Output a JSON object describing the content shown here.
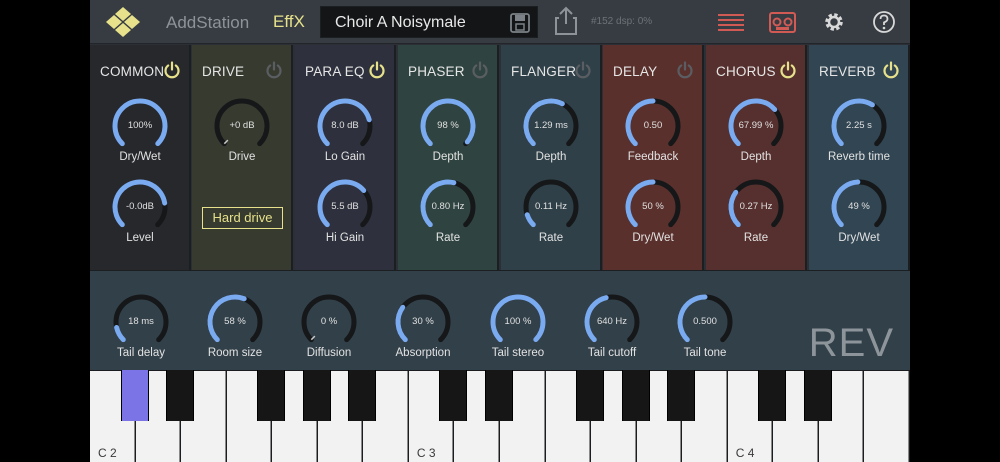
{
  "header": {
    "app_name": "AddStation",
    "module": "EffX",
    "preset_name": "Choir A Noisymale",
    "status": "#152  dsp: 0%"
  },
  "effects": [
    {
      "title": "COMMON",
      "power": "on",
      "color": "#26282c",
      "knobs": [
        {
          "value": "100%",
          "label": "Dry/Wet",
          "fill": 1.0
        },
        {
          "value": "-0.0dB",
          "label": "Level",
          "fill": 0.8
        }
      ]
    },
    {
      "title": "DRIVE",
      "power": "off",
      "color": "#363a2f",
      "knobs": [
        {
          "value": "+0 dB",
          "label": "Drive",
          "fill": 0.0
        }
      ],
      "button": "Hard drive"
    },
    {
      "title": "PARA EQ",
      "power": "on",
      "color": "#2e313d",
      "knobs": [
        {
          "value": "8.0 dB",
          "label": "Lo Gain",
          "fill": 0.78
        },
        {
          "value": "5.5 dB",
          "label": "Hi Gain",
          "fill": 0.68
        }
      ]
    },
    {
      "title": "PHASER",
      "power": "off",
      "color": "#2f4440",
      "knobs": [
        {
          "value": "98 %",
          "label": "Depth",
          "fill": 0.98
        },
        {
          "value": "0.80 Hz",
          "label": "Rate",
          "fill": 0.55
        }
      ]
    },
    {
      "title": "FLANGER",
      "power": "off",
      "color": "#2f4048",
      "knobs": [
        {
          "value": "1.29  ms",
          "label": "Depth",
          "fill": 0.6
        },
        {
          "value": "0.11  Hz",
          "label": "Rate",
          "fill": 0.1
        }
      ]
    },
    {
      "title": "DELAY",
      "power": "off",
      "color": "#5a302c",
      "knobs": [
        {
          "value": "0.50",
          "label": "Feedback",
          "fill": 0.5
        },
        {
          "value": "50   %",
          "label": "Dry/Wet",
          "fill": 0.5
        }
      ]
    },
    {
      "title": "CHORUS",
      "power": "on",
      "color": "#56302e",
      "knobs": [
        {
          "value": "67.99 %",
          "label": "Depth",
          "fill": 0.68
        },
        {
          "value": "0.27  Hz",
          "label": "Rate",
          "fill": 0.3
        }
      ]
    },
    {
      "title": "REVERB",
      "power": "on",
      "color": "#314552",
      "knobs": [
        {
          "value": "2.25 s",
          "label": "Reverb time",
          "fill": 0.62
        },
        {
          "value": "49 %",
          "label": "Dry/Wet",
          "fill": 0.49
        }
      ]
    }
  ],
  "reverb_detail": {
    "title": "REV",
    "knobs": [
      {
        "value": "18 ms",
        "label": "Tail delay",
        "fill": 0.12
      },
      {
        "value": "58 %",
        "label": "Room size",
        "fill": 0.58
      },
      {
        "value": "0 %",
        "label": "Diffusion",
        "fill": 0.0
      },
      {
        "value": "30 %",
        "label": "Absorption",
        "fill": 0.3
      },
      {
        "value": "100 %",
        "label": "Tail stereo",
        "fill": 1.0
      },
      {
        "value": "640 Hz",
        "label": "Tail cutoff",
        "fill": 0.45
      },
      {
        "value": "0.500",
        "label": "Tail tone",
        "fill": 0.5
      }
    ]
  },
  "keyboard": {
    "octave_labels": [
      "C 2",
      "C 3",
      "C 4"
    ],
    "active_key": "C#2"
  },
  "colors": {
    "accent": "#7aaaf0",
    "power_on": "#e6e18a",
    "power_off": "#5a5e62"
  }
}
